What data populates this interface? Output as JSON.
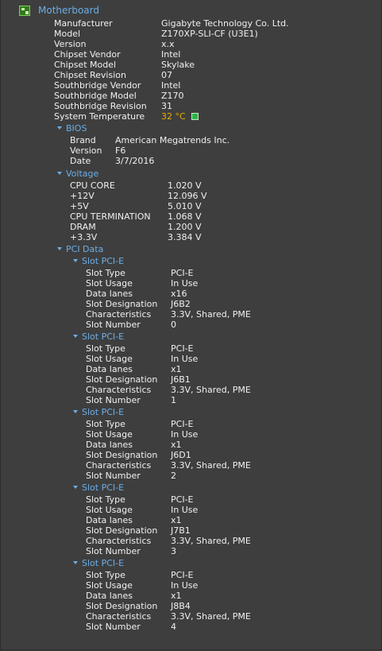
{
  "root": {
    "label": "Motherboard",
    "icon": "motherboard-icon"
  },
  "main": [
    {
      "key": "Manufacturer",
      "value": "Gigabyte Technology Co. Ltd."
    },
    {
      "key": "Model",
      "value": "Z170XP-SLI-CF (U3E1)"
    },
    {
      "key": "Version",
      "value": "x.x"
    },
    {
      "key": "Chipset Vendor",
      "value": "Intel"
    },
    {
      "key": "Chipset Model",
      "value": "Skylake"
    },
    {
      "key": "Chipset Revision",
      "value": "07"
    },
    {
      "key": "Southbridge Vendor",
      "value": "Intel"
    },
    {
      "key": "Southbridge Model",
      "value": "Z170"
    },
    {
      "key": "Southbridge Revision",
      "value": "31"
    }
  ],
  "temperature": {
    "key": "System Temperature",
    "value": "32 °C",
    "color": "#e5b000",
    "icon": "temperature-status-icon"
  },
  "bios": {
    "title": "BIOS",
    "rows": [
      {
        "key": "Brand",
        "value": "American Megatrends Inc."
      },
      {
        "key": "Version",
        "value": "F6"
      },
      {
        "key": "Date",
        "value": "3/7/2016"
      }
    ]
  },
  "voltage": {
    "title": "Voltage",
    "rows": [
      {
        "key": "CPU CORE",
        "value": "1.020 V"
      },
      {
        "key": "+12V",
        "value": "12.096 V"
      },
      {
        "key": "+5V",
        "value": "5.010 V"
      },
      {
        "key": "CPU TERMINATION",
        "value": "1.068 V"
      },
      {
        "key": "DRAM",
        "value": "1.200 V"
      },
      {
        "key": "+3.3V",
        "value": "3.384 V"
      }
    ]
  },
  "pci": {
    "title": "PCI Data",
    "slots": [
      {
        "title": "Slot PCI-E",
        "rows": [
          {
            "key": "Slot Type",
            "value": "PCI-E"
          },
          {
            "key": "Slot Usage",
            "value": "In Use"
          },
          {
            "key": "Data lanes",
            "value": "x16"
          },
          {
            "key": "Slot Designation",
            "value": "J6B2"
          },
          {
            "key": "Characteristics",
            "value": "3.3V, Shared, PME"
          },
          {
            "key": "Slot Number",
            "value": "0"
          }
        ]
      },
      {
        "title": "Slot PCI-E",
        "rows": [
          {
            "key": "Slot Type",
            "value": "PCI-E"
          },
          {
            "key": "Slot Usage",
            "value": "In Use"
          },
          {
            "key": "Data lanes",
            "value": "x1"
          },
          {
            "key": "Slot Designation",
            "value": "J6B1"
          },
          {
            "key": "Characteristics",
            "value": "3.3V, Shared, PME"
          },
          {
            "key": "Slot Number",
            "value": "1"
          }
        ]
      },
      {
        "title": "Slot PCI-E",
        "rows": [
          {
            "key": "Slot Type",
            "value": "PCI-E"
          },
          {
            "key": "Slot Usage",
            "value": "In Use"
          },
          {
            "key": "Data lanes",
            "value": "x1"
          },
          {
            "key": "Slot Designation",
            "value": "J6D1"
          },
          {
            "key": "Characteristics",
            "value": "3.3V, Shared, PME"
          },
          {
            "key": "Slot Number",
            "value": "2"
          }
        ]
      },
      {
        "title": "Slot PCI-E",
        "rows": [
          {
            "key": "Slot Type",
            "value": "PCI-E"
          },
          {
            "key": "Slot Usage",
            "value": "In Use"
          },
          {
            "key": "Data lanes",
            "value": "x1"
          },
          {
            "key": "Slot Designation",
            "value": "J7B1"
          },
          {
            "key": "Characteristics",
            "value": "3.3V, Shared, PME"
          },
          {
            "key": "Slot Number",
            "value": "3"
          }
        ]
      },
      {
        "title": "Slot PCI-E",
        "rows": [
          {
            "key": "Slot Type",
            "value": "PCI-E"
          },
          {
            "key": "Slot Usage",
            "value": "In Use"
          },
          {
            "key": "Data lanes",
            "value": "x1"
          },
          {
            "key": "Slot Designation",
            "value": "J8B4"
          },
          {
            "key": "Characteristics",
            "value": "3.3V, Shared, PME"
          },
          {
            "key": "Slot Number",
            "value": "4"
          }
        ]
      }
    ]
  }
}
